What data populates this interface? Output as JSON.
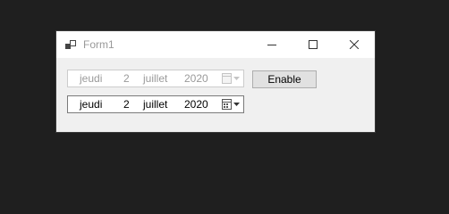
{
  "window": {
    "title": "Form1",
    "controls": {
      "minimize": "minimize-icon",
      "maximize": "maximize-icon",
      "close": "close-icon"
    }
  },
  "date_picker_disabled": {
    "day_name": "jeudi",
    "day": "2",
    "month": "juillet",
    "year": "2020",
    "icon": "calendar-dropdown-icon"
  },
  "date_picker_enabled": {
    "day_name": "jeudi",
    "day": "2",
    "month": "juillet",
    "year": "2020",
    "icon": "calendar-dropdown-icon"
  },
  "enable_button": {
    "label": "Enable"
  },
  "colors": {
    "desktop": "#1f1f1f",
    "window_bg": "#f0f0f0",
    "titlebar_bg": "#ffffff",
    "disabled_text": "#9a9a9a",
    "button_bg": "#e1e1e1"
  }
}
